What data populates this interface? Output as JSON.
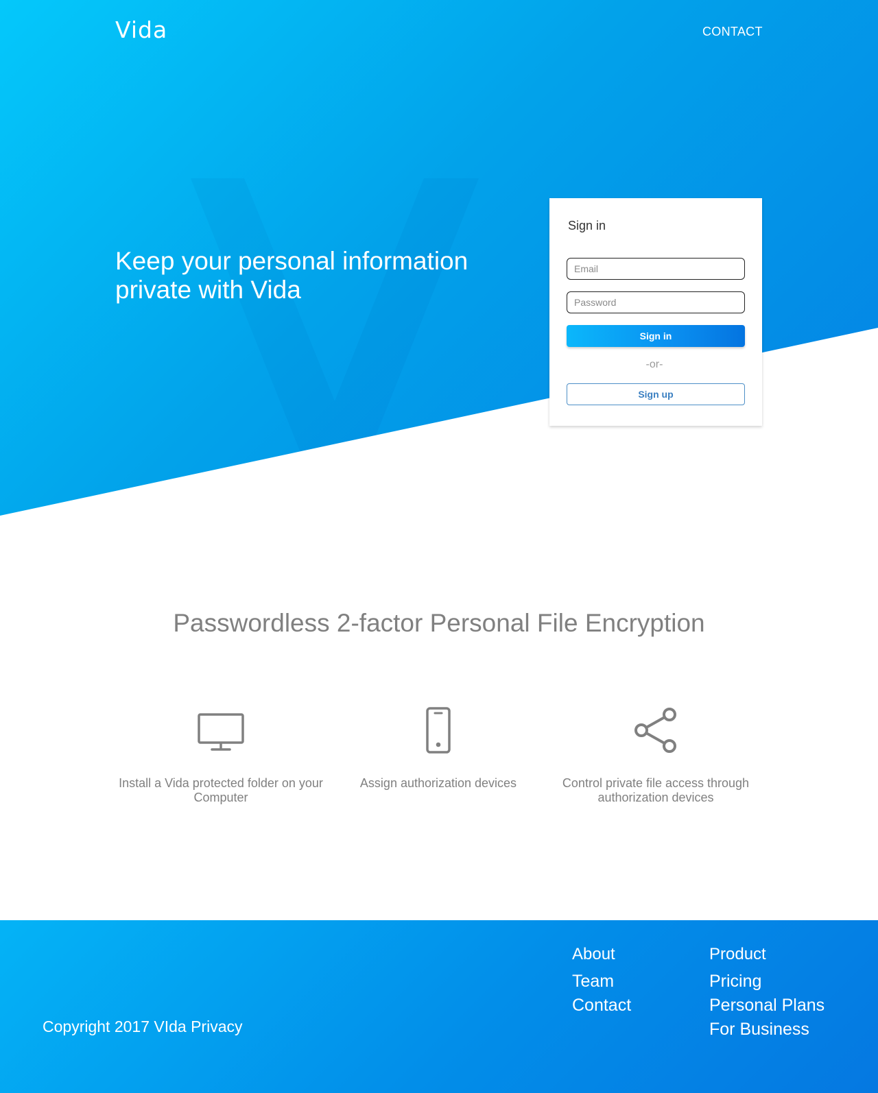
{
  "header": {
    "logo_text": "Vida",
    "nav_contact": "CONTACT"
  },
  "hero": {
    "tagline": "Keep your personal information private with Vida",
    "background_colors": [
      "#04c8fb",
      "#02a2ea",
      "#0481e4"
    ]
  },
  "signin": {
    "title": "Sign in",
    "email_placeholder": "Email",
    "email_value": "",
    "password_placeholder": "Password",
    "password_value": "",
    "signin_button": "Sign in",
    "or_text": "-or-",
    "signup_button": "Sign up"
  },
  "features": {
    "heading": "Passwordless 2-factor Personal File Encryption",
    "items": [
      {
        "icon": "monitor-icon",
        "text": "Install a Vida protected folder on your Computer"
      },
      {
        "icon": "smartphone-icon",
        "text": "Assign authorization devices"
      },
      {
        "icon": "share-icon",
        "text": "Control private file access through authorization devices"
      }
    ],
    "text_color": "#808080"
  },
  "footer": {
    "copyright": "Copyright 2017 VIda Privacy",
    "about": {
      "heading": "About",
      "links": [
        "Team",
        "Contact"
      ]
    },
    "product": {
      "heading": "Product",
      "links": [
        "Pricing",
        "Personal Plans",
        "For Business"
      ]
    }
  }
}
